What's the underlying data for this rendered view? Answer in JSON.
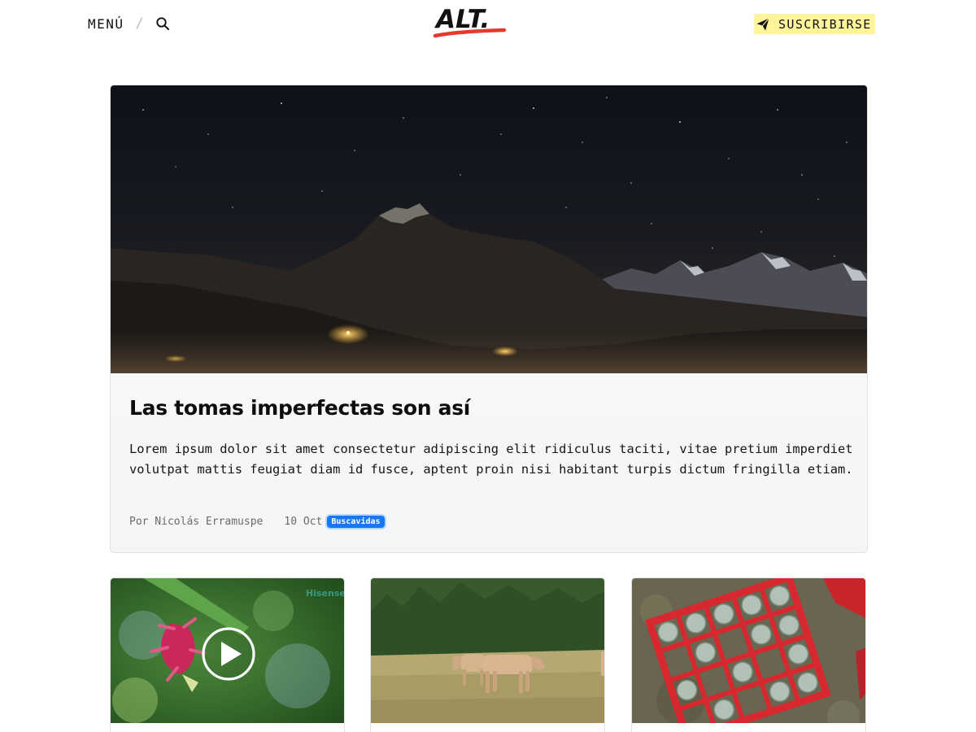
{
  "header": {
    "menu_label": "MENÚ",
    "separator": "/",
    "logo_text": "ALT.",
    "subscribe_label": "SUSCRIBIRSE",
    "accent_color": "#fff49a",
    "logo_underline_color": "#e63a2e"
  },
  "icons": {
    "search": "search-icon",
    "subscribe": "paper-plane-icon",
    "play": "play-icon"
  },
  "featured": {
    "title": "Las tomas imperfectas son así",
    "excerpt": "Lorem ipsum dolor sit amet consectetur adipiscing elit ridiculus taciti, vitae pretium imperdiet volutpat mattis feugiat diam id fusce, aptent proin nisi habitant turpis dictum fringilla etiam.",
    "author": "Por Nicolás Erramuspe",
    "date": "10 Oct",
    "tag": "Buscavidas",
    "tag_color": "#1877f2"
  },
  "cards": [
    {
      "image": "dragon-fruit-flower",
      "watermark": "Hisense",
      "has_video": true
    },
    {
      "image": "cows-in-field",
      "has_video": false
    },
    {
      "image": "bottle-crate",
      "has_video": false
    }
  ]
}
